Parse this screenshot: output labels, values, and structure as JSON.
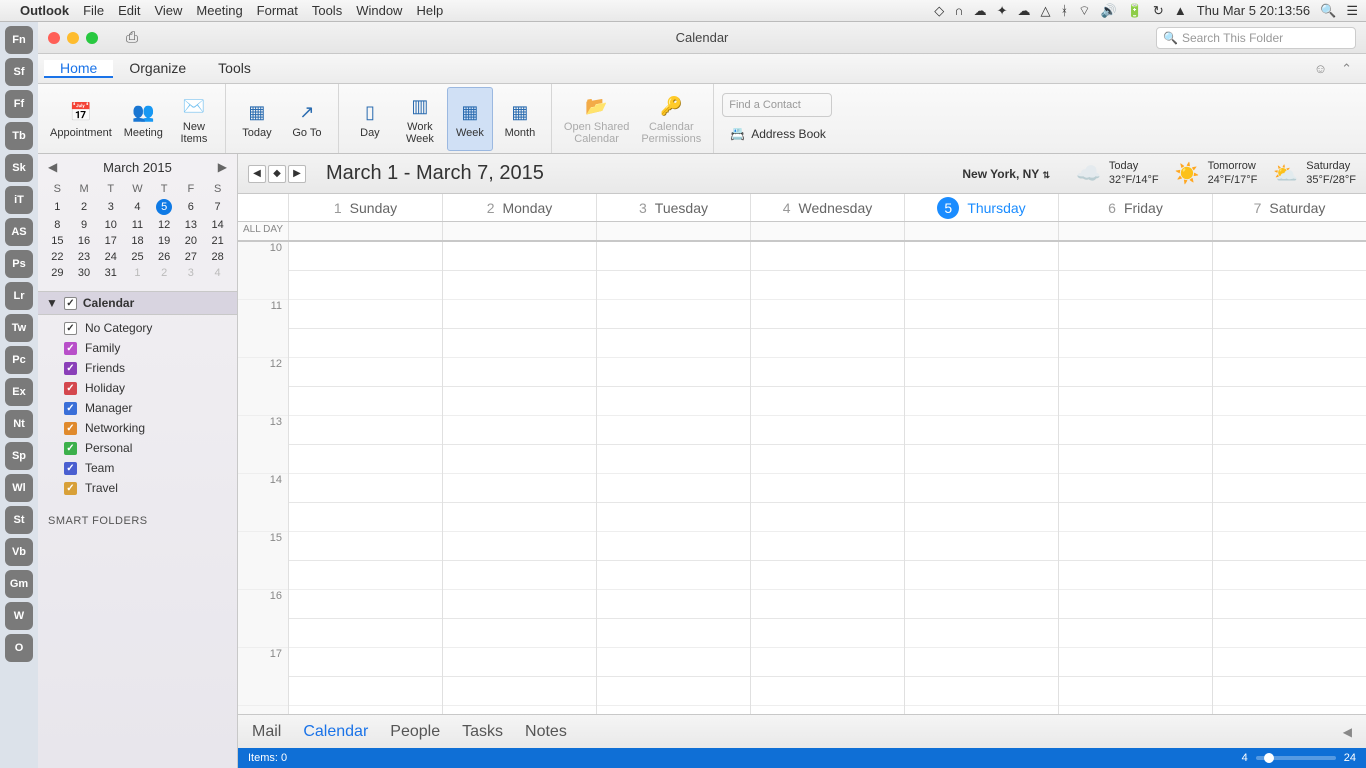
{
  "menubar": {
    "app": "Outlook",
    "items": [
      "File",
      "Edit",
      "View",
      "Meeting",
      "Format",
      "Tools",
      "Window",
      "Help"
    ],
    "clock": "Thu Mar 5  20:13:56"
  },
  "dock": [
    "Fn",
    "Sf",
    "Ff",
    "Tb",
    "Sk",
    "iT",
    "AS",
    "Ps",
    "Lr",
    "Tw",
    "Pc",
    "Ex",
    "Nt",
    "Sp",
    "Wl",
    "St",
    "Vb",
    "Gm",
    "W",
    "O"
  ],
  "titlebar": {
    "title": "Calendar",
    "search_placeholder": "Search This Folder"
  },
  "tabs": {
    "items": [
      "Home",
      "Organize",
      "Tools"
    ],
    "active": 0
  },
  "ribbon": {
    "appointment": "Appointment",
    "meeting": "Meeting",
    "new_items": "New\nItems",
    "today": "Today",
    "goto": "Go To",
    "day": "Day",
    "work_week": "Work\nWeek",
    "week": "Week",
    "month": "Month",
    "open_shared": "Open Shared\nCalendar",
    "permissions": "Calendar\nPermissions",
    "find_contact": "Find a Contact",
    "address_book": "Address Book"
  },
  "sidebar": {
    "month_title": "March 2015",
    "dow": [
      "S",
      "M",
      "T",
      "W",
      "T",
      "F",
      "S"
    ],
    "weeks": [
      [
        {
          "d": "1"
        },
        {
          "d": "2"
        },
        {
          "d": "3"
        },
        {
          "d": "4"
        },
        {
          "d": "5",
          "today": true
        },
        {
          "d": "6"
        },
        {
          "d": "7"
        }
      ],
      [
        {
          "d": "8"
        },
        {
          "d": "9"
        },
        {
          "d": "10"
        },
        {
          "d": "11"
        },
        {
          "d": "12"
        },
        {
          "d": "13"
        },
        {
          "d": "14"
        }
      ],
      [
        {
          "d": "15"
        },
        {
          "d": "16"
        },
        {
          "d": "17"
        },
        {
          "d": "18"
        },
        {
          "d": "19"
        },
        {
          "d": "20"
        },
        {
          "d": "21"
        }
      ],
      [
        {
          "d": "22"
        },
        {
          "d": "23"
        },
        {
          "d": "24"
        },
        {
          "d": "25"
        },
        {
          "d": "26"
        },
        {
          "d": "27"
        },
        {
          "d": "28"
        }
      ],
      [
        {
          "d": "29"
        },
        {
          "d": "30"
        },
        {
          "d": "31"
        },
        {
          "d": "1",
          "out": true
        },
        {
          "d": "2",
          "out": true
        },
        {
          "d": "3",
          "out": true
        },
        {
          "d": "4",
          "out": true
        }
      ]
    ],
    "calendar_label": "Calendar",
    "categories": [
      {
        "name": "No Category",
        "color": "#fff",
        "border": "#888"
      },
      {
        "name": "Family",
        "color": "#b84fc9"
      },
      {
        "name": "Friends",
        "color": "#8a3fb8"
      },
      {
        "name": "Holiday",
        "color": "#d4474d"
      },
      {
        "name": "Manager",
        "color": "#3a6fd8"
      },
      {
        "name": "Networking",
        "color": "#e08a2c"
      },
      {
        "name": "Personal",
        "color": "#3cb04b"
      },
      {
        "name": "Team",
        "color": "#4a5fd0"
      },
      {
        "name": "Travel",
        "color": "#d8a038"
      }
    ],
    "smart_folders": "SMART FOLDERS"
  },
  "infobar": {
    "range": "March 1 - March 7, 2015",
    "location": "New York, NY",
    "weather": [
      {
        "label": "Today",
        "temps": "32°F/14°F",
        "icon": "☁️"
      },
      {
        "label": "Tomorrow",
        "temps": "24°F/17°F",
        "icon": "☀️"
      },
      {
        "label": "Saturday",
        "temps": "35°F/28°F",
        "icon": "⛅"
      }
    ]
  },
  "week": {
    "all_day": "ALL DAY",
    "days": [
      {
        "num": "1",
        "name": "Sunday"
      },
      {
        "num": "2",
        "name": "Monday"
      },
      {
        "num": "3",
        "name": "Tuesday"
      },
      {
        "num": "4",
        "name": "Wednesday"
      },
      {
        "num": "5",
        "name": "Thursday",
        "today": true
      },
      {
        "num": "6",
        "name": "Friday"
      },
      {
        "num": "7",
        "name": "Saturday"
      }
    ],
    "hours": [
      "10",
      "11",
      "12",
      "13",
      "14",
      "15",
      "16",
      "17"
    ]
  },
  "viewnav": {
    "items": [
      "Mail",
      "Calendar",
      "People",
      "Tasks",
      "Notes"
    ],
    "active": 1
  },
  "status": {
    "items_label": "Items:",
    "items_count": "0",
    "zoom_min": "4",
    "zoom_max": "24"
  }
}
